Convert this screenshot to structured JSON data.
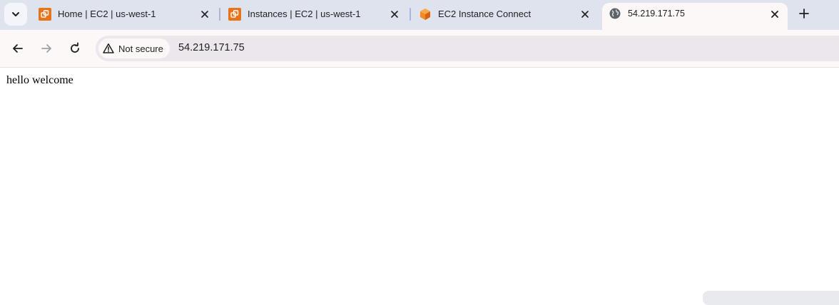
{
  "browser": {
    "tabs": [
      {
        "title": "Home | EC2 | us-west-1",
        "favicon": "aws-ec2-icon",
        "active": false
      },
      {
        "title": "Instances | EC2 | us-west-1",
        "favicon": "aws-ec2-icon",
        "active": false
      },
      {
        "title": "EC2 Instance Connect",
        "favicon": "aws-cube-icon",
        "active": false
      },
      {
        "title": "54.219.171.75",
        "favicon": "globe-icon",
        "active": true
      }
    ],
    "security_chip": "Not secure",
    "url": "54.219.171.75"
  },
  "page": {
    "body_text": "hello welcome"
  },
  "colors": {
    "tabstrip": "#dfe3ee",
    "active_tab": "#fdf8f8",
    "aws_orange": "#e8741a",
    "omnibox": "#ebe7ec"
  }
}
